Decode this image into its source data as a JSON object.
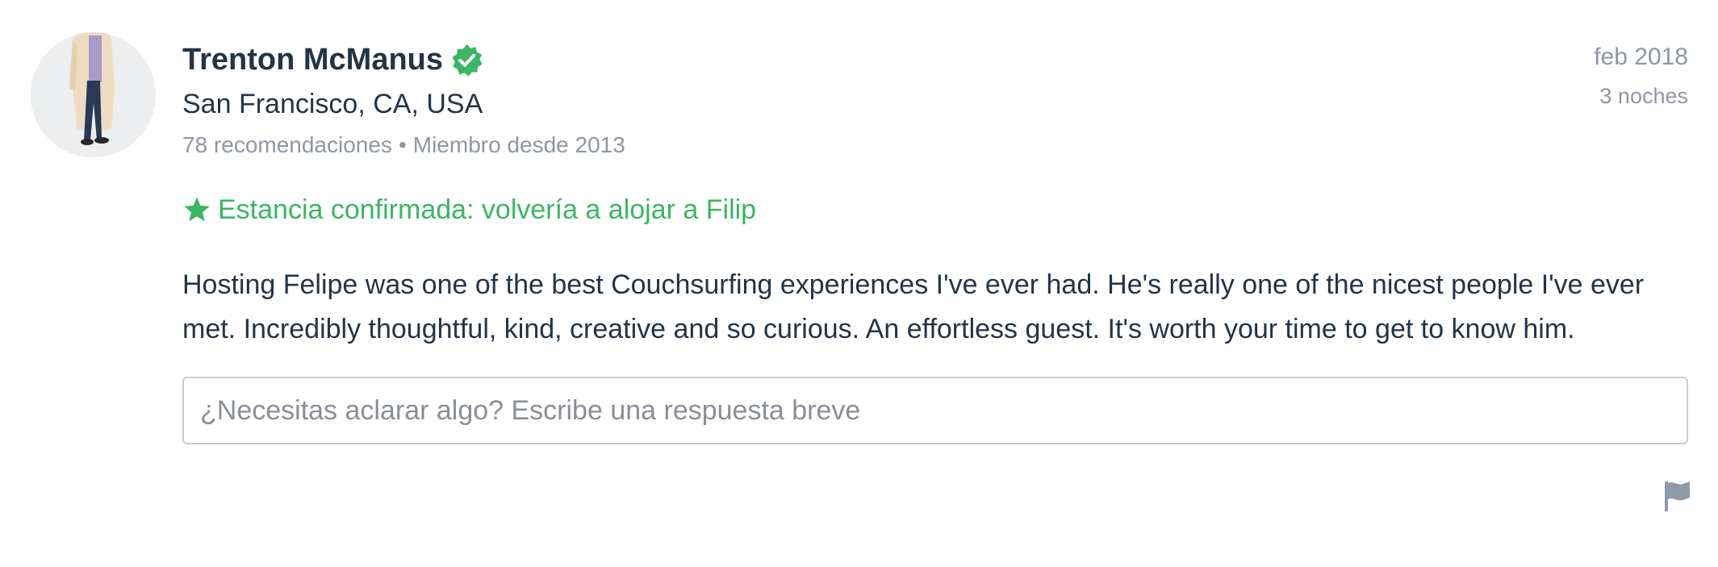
{
  "reviewer": {
    "name": "Trenton McManus",
    "verified_icon": "verified-badge-icon",
    "location": "San Francisco, CA, USA",
    "recommendations": "78 recomendaciones",
    "separator": "•",
    "member_since": "Miembro desde 2013"
  },
  "stay": {
    "date": "feb 2018",
    "nights": "3 noches"
  },
  "confirmation": {
    "icon": "star-icon",
    "text": "Estancia confirmada: volvería a alojar a Filip"
  },
  "review_text": "Hosting Felipe was one of the best Couchsurfing experiences I've ever had. He's really one of the nicest people I've ever met. Incredibly thoughtful, kind, creative and so curious. An effortless guest. It's worth your time to get to know him.",
  "reply": {
    "placeholder": "¿Necesitas aclarar algo? Escribe una respuesta breve",
    "value": ""
  },
  "report": {
    "icon": "flag-icon"
  },
  "colors": {
    "verified_green": "#3bb663",
    "confirmed_green": "#3bb663",
    "text_dark": "#243447",
    "text_muted": "#8e97a3",
    "flag_gray": "#8d9aa8"
  }
}
